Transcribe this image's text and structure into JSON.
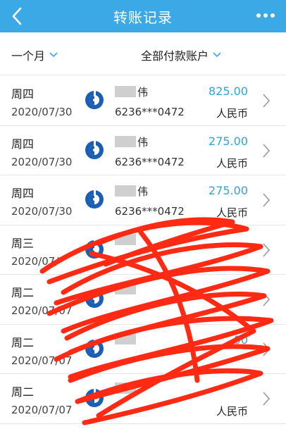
{
  "header": {
    "title": "转账记录"
  },
  "filters": {
    "period": "一个月",
    "account": "全部付款账户"
  },
  "colors": {
    "header_bg": "#3aa9e6",
    "amount": "#2fa4e0",
    "bank_icon": "#1b5fb5",
    "scribble": "#ff2a14"
  },
  "transfers": [
    {
      "weekday": "周四",
      "date": "2020/07/30",
      "name": "伟",
      "account": "6236***0472",
      "amount": "825.00",
      "currency": "人民币",
      "icon": "ccb-bank-icon"
    },
    {
      "weekday": "周四",
      "date": "2020/07/30",
      "name": "伟",
      "account": "6236***0472",
      "amount": "275.00",
      "currency": "人民币",
      "icon": "ccb-bank-icon"
    },
    {
      "weekday": "周四",
      "date": "2020/07/30",
      "name": "伟",
      "account": "6236***0472",
      "amount": "275.00",
      "currency": "人民币",
      "icon": "ccb-bank-icon"
    },
    {
      "weekday": "周三",
      "date": "2020/07/",
      "name": "",
      "account": "",
      "amount": "",
      "currency": "",
      "icon": "bank-icon"
    },
    {
      "weekday": "周二",
      "date": "2020/07/07",
      "name": "",
      "account": "",
      "amount": "",
      "currency": "",
      "icon": "bank-icon"
    },
    {
      "weekday": "周二",
      "date": "2020/07/07",
      "name": "",
      "account": "",
      "amount": "00",
      "currency": "",
      "icon": "bank-icon"
    },
    {
      "weekday": "周二",
      "date": "2020/07/07",
      "name": "",
      "account": "",
      "amount": "",
      "currency": "人民币",
      "icon": "bank-icon"
    }
  ]
}
